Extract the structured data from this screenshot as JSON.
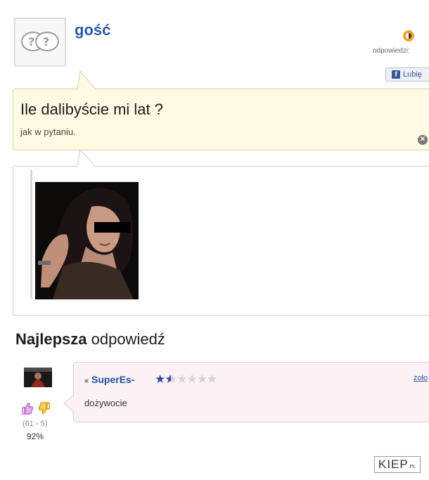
{
  "header": {
    "username": "gość",
    "answers_label": "odpowiedzi:",
    "like_label": "Lubię",
    "like_icon": "facebook-icon"
  },
  "question": {
    "title": "Ile dalibyście mi lat ?",
    "description": "jak w pytaniu."
  },
  "best_answer": {
    "heading_bold": "Najlepsza",
    "heading_rest": " odpowiedź",
    "user": "SuperEs-",
    "stars_filled": 1.5,
    "stars_total": 6,
    "rank_link": "zoło",
    "text": "dożywocie",
    "votes": "(61 - 5)",
    "percent": "92%"
  },
  "watermark": {
    "main": "KIEP",
    "suffix": ".PL"
  },
  "colors": {
    "link_blue": "#2a5aa6",
    "question_bg": "#fefbe2",
    "answer_bg": "#fcf2f5",
    "thumb_up": "#c06fc4",
    "thumb_down": "#e6b628"
  }
}
